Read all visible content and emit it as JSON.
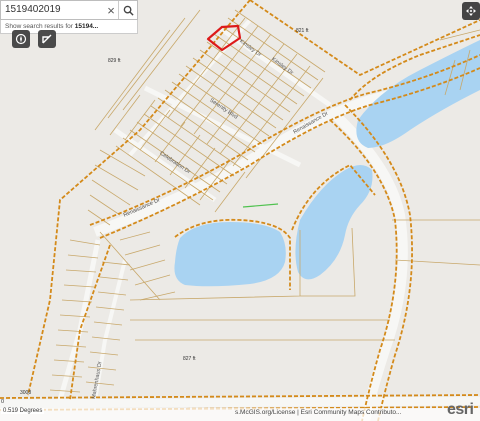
{
  "search": {
    "value": "1519402019",
    "clear_glyph": "×",
    "suggest_prefix": "Show search results for ",
    "suggest_term": "15194..."
  },
  "tools": {
    "expand_icon": "expand-icon",
    "home_icon": "compass-icon",
    "locate_icon": "locate-arrow-icon"
  },
  "colors": {
    "background": "#eceae6",
    "parcel_line": "#c8a86b",
    "boundary_dash": "#d48a1a",
    "water": "#a9d3f2",
    "road": "#f7f7f5",
    "selected_parcel": "#dd1a1a"
  },
  "map_labels": {
    "street_kinsley_a": "Kinsley Dr",
    "street_kinsley_b": "Kinsley Dr",
    "street_serenity": "Serenity Blvd",
    "street_celebration": "Celebration Dr",
    "street_renaissance_a": "Renaissance Dr",
    "street_renaissance_b": "Renaissance Dr",
    "street_mahrenhaus": "Mahrenhaus Dr",
    "contour_1": "821 ft",
    "contour_2": "829 ft",
    "contour_3": "827 ft",
    "road_3008": "3008"
  },
  "footer": {
    "scale": "0",
    "coordinates": "0.519 Degrees",
    "attribution": "s.McGIS.org/License | Esri Community Maps Contributo...",
    "logo": "esri"
  }
}
